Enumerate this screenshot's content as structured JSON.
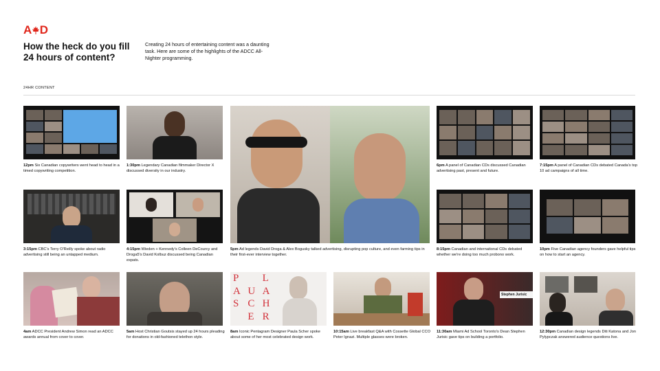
{
  "header": {
    "logo_left": "A",
    "logo_right": "D",
    "headline": "How the heck do you fill 24 hours of content?",
    "intro": "Creating 24 hours of entertaining content was a daunting task.  Here are some of the highlights of the ADCC All-Nighter programming.",
    "section_label": "24HR CONTENT"
  },
  "tiles": [
    {
      "time": "12pm",
      "text": "Six Canadian copywriters went head to head in a timed copywriting competition."
    },
    {
      "time": "1:30pm",
      "text": "Legendary Canadian filmmaker Director X discussed diversity in our industry."
    },
    {
      "time": "5pm",
      "text": "Ad legends David Droga & Alex Bogusky talked advertising, disrupting pop culture, and even farming tips in their first-ever interview together."
    },
    {
      "time": "6pm",
      "text": "A panel of Canadian CDs discussed Canadian advertising past, present and future."
    },
    {
      "time": "7:15pm",
      "text": "A panel of Canadian CDs debated Canada's top 10 ad campaigns of all time."
    },
    {
      "time": "3:15pm",
      "text": "CBC's Terry O'Reilly spoke about radio advertising still being an untapped medium."
    },
    {
      "time": "4:15pm",
      "text": "Wieden + Kennedy's Colleen DeCourcy and Droga5's David Kolbuz discussed being Canadian expats."
    },
    {
      "time": "8:15pm",
      "text": "Canadian and international CDs debated whether we're doing too much probono work."
    },
    {
      "time": "10pm",
      "text": "Five Canadian agency founders gave helpful tips on how to start an agency."
    },
    {
      "time": "4am",
      "text": "ADCC President Andrew Simon read an ADCC awards annual from cover to cover."
    },
    {
      "time": "5am",
      "text": "Host Christian Goutsis stayed up 24 hours pleading for donations in old-fashioned telethon style."
    },
    {
      "time": "8am",
      "text": "Iconic Pentagram Designer Paula Scher spoke about some of her most celebrated design work."
    },
    {
      "time": "10:15am",
      "text": "Live breakfast Q&A with Cossette Global CCO Peter Ignazi. Multiple glasses were broken."
    },
    {
      "time": "11:30am",
      "text": "Miami Ad School Toronto's Dean Stephen Jurisic gave tips on building a portfolio."
    },
    {
      "time": "12:30pm",
      "text": "Canadian design legends Diti Katona and Jon Pylypczak answered audience questions live."
    }
  ],
  "images": {
    "scher_letters": [
      "P",
      "A",
      "U",
      "L",
      "A",
      "S",
      "C",
      "H",
      "E",
      "R"
    ],
    "jurisic_name": "Stephen Jurisic"
  },
  "colors": {
    "brand_red": "#e0261b"
  }
}
